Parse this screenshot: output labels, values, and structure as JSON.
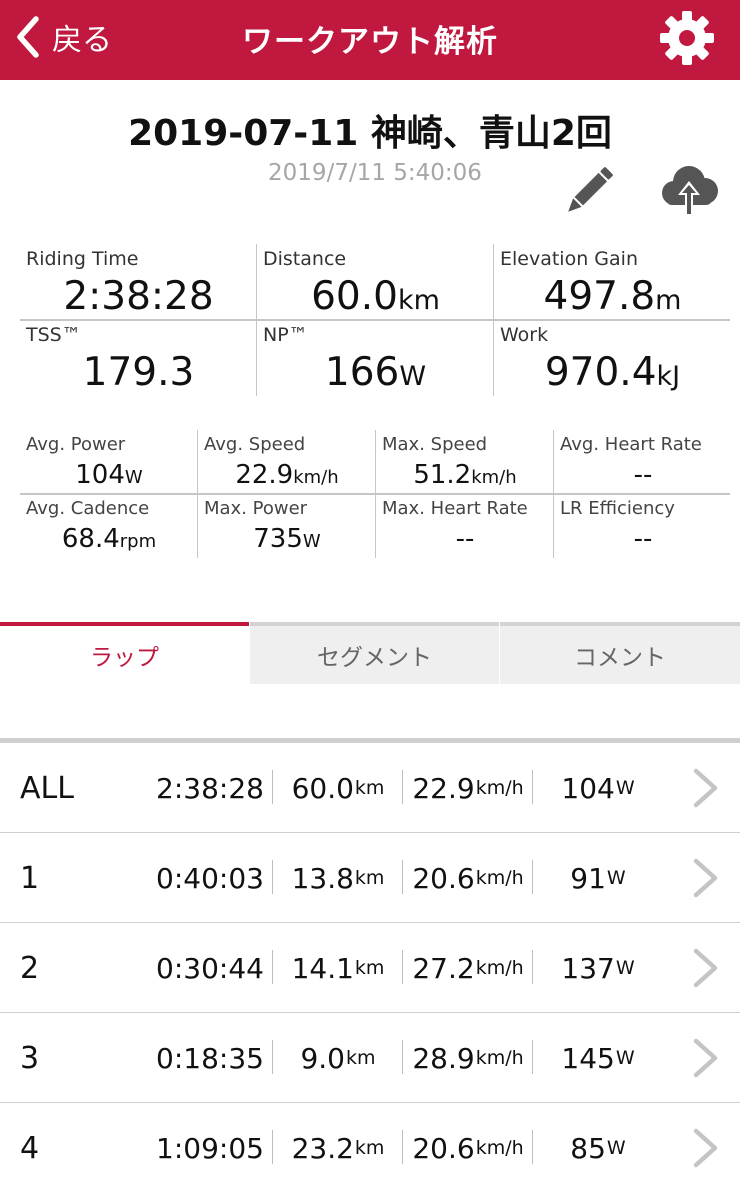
{
  "nav": {
    "back_label": "戻る",
    "title": "ワークアウト解析",
    "back_icon": "chevron-left-icon",
    "settings_icon": "gear-icon"
  },
  "workout": {
    "title": "2019-07-11 神崎、青山2回",
    "datetime": "2019/7/11 5:40:06",
    "edit_icon": "pencil-icon",
    "upload_icon": "cloud-upload-icon"
  },
  "summary": [
    {
      "label": "Riding Time",
      "value": "2:38:28",
      "unit": ""
    },
    {
      "label": "Distance",
      "value": "60.0",
      "unit": "km"
    },
    {
      "label": "Elevation Gain",
      "value": "497.8",
      "unit": "m"
    },
    {
      "label": "TSS™",
      "value": "179.3",
      "unit": ""
    },
    {
      "label": "NP™",
      "value": "166",
      "unit": "W"
    },
    {
      "label": "Work",
      "value": "970.4",
      "unit": "kJ"
    }
  ],
  "details": [
    {
      "label": "Avg. Power",
      "value": "104",
      "unit": "W"
    },
    {
      "label": "Avg. Speed",
      "value": "22.9",
      "unit": "km/h"
    },
    {
      "label": "Max. Speed",
      "value": "51.2",
      "unit": "km/h"
    },
    {
      "label": "Avg. Heart Rate",
      "value": "--",
      "unit": ""
    },
    {
      "label": "Avg. Cadence",
      "value": "68.4",
      "unit": "rpm"
    },
    {
      "label": "Max. Power",
      "value": "735",
      "unit": "W"
    },
    {
      "label": "Max. Heart Rate",
      "value": "--",
      "unit": ""
    },
    {
      "label": "LR Efficiency",
      "value": "--",
      "unit": ""
    }
  ],
  "tabs": [
    {
      "label": "ラップ",
      "active": true
    },
    {
      "label": "セグメント",
      "active": false
    },
    {
      "label": "コメント",
      "active": false
    }
  ],
  "laps": [
    {
      "name": "ALL",
      "time": "2:38:28",
      "distance": "60.0",
      "distance_unit": "km",
      "speed": "22.9",
      "speed_unit": "km/h",
      "power": "104",
      "power_unit": "W"
    },
    {
      "name": "1",
      "time": "0:40:03",
      "distance": "13.8",
      "distance_unit": "km",
      "speed": "20.6",
      "speed_unit": "km/h",
      "power": "91",
      "power_unit": "W"
    },
    {
      "name": "2",
      "time": "0:30:44",
      "distance": "14.1",
      "distance_unit": "km",
      "speed": "27.2",
      "speed_unit": "km/h",
      "power": "137",
      "power_unit": "W"
    },
    {
      "name": "3",
      "time": "0:18:35",
      "distance": "9.0",
      "distance_unit": "km",
      "speed": "28.9",
      "speed_unit": "km/h",
      "power": "145",
      "power_unit": "W"
    },
    {
      "name": "4",
      "time": "1:09:05",
      "distance": "23.2",
      "distance_unit": "km",
      "speed": "20.6",
      "speed_unit": "km/h",
      "power": "85",
      "power_unit": "W"
    }
  ],
  "colors": {
    "accent": "#c0183e",
    "muted": "#a6a6a6",
    "icon_gray": "#555555"
  }
}
